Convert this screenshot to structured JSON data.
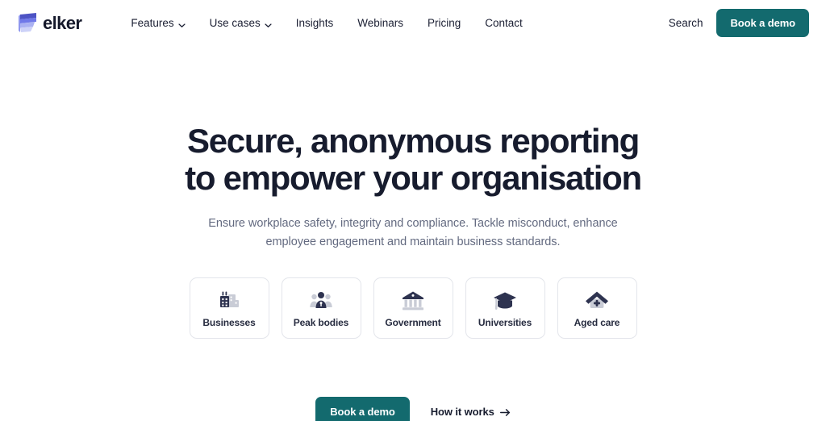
{
  "header": {
    "brand": {
      "name": "elker",
      "logo_icon": "elker-logo-icon",
      "logo_colors": [
        "#4d53c4",
        "#6f78e8",
        "#aab1f2",
        "#cdd2f8"
      ]
    },
    "nav": [
      {
        "label": "Features",
        "has_dropdown": true,
        "icon": "chevron-down-icon"
      },
      {
        "label": "Use cases",
        "has_dropdown": true,
        "icon": "chevron-down-icon"
      },
      {
        "label": "Insights",
        "has_dropdown": false
      },
      {
        "label": "Webinars",
        "has_dropdown": false
      },
      {
        "label": "Pricing",
        "has_dropdown": false
      },
      {
        "label": "Contact",
        "has_dropdown": false
      }
    ],
    "search_label": "Search",
    "demo_button_label": "Book a demo",
    "accent_color": "#136a6e"
  },
  "hero": {
    "title": "Secure, anonymous reporting to empower your organisation",
    "subtitle": "Ensure workplace safety, integrity and compliance. Tackle misconduct, enhance employee engagement and maintain business standards.",
    "title_color": "#171c2e",
    "subtitle_color": "#636a80"
  },
  "categories": [
    {
      "label": "Businesses",
      "icon": "office-buildings-icon"
    },
    {
      "label": "Peak bodies",
      "icon": "people-group-icon"
    },
    {
      "label": "Government",
      "icon": "government-building-icon"
    },
    {
      "label": "Universities",
      "icon": "graduation-cap-icon"
    },
    {
      "label": "Aged care",
      "icon": "house-medical-icon"
    }
  ],
  "cta": {
    "primary_label": "Book a demo",
    "secondary_label": "How it works",
    "secondary_icon": "arrow-right-icon",
    "primary_color": "#136a6e"
  },
  "icon_palette": {
    "dark": "#2e3350",
    "light": "#c9ccd6"
  }
}
